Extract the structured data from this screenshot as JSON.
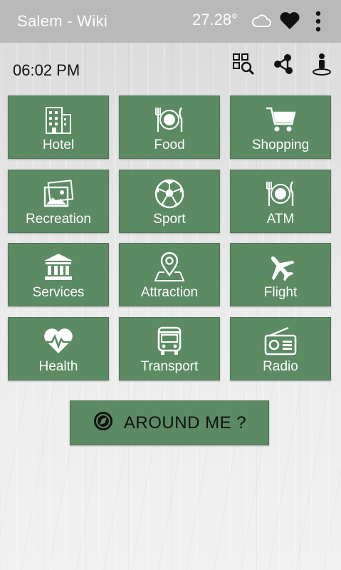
{
  "appbar": {
    "title": "Salem - Wiki",
    "temperature": "27.28°",
    "icons": [
      "cloud-icon",
      "heart-icon",
      "more-vert-icon"
    ]
  },
  "toolbar": {
    "time": "06:02 PM",
    "icons": [
      "qr-search-icon",
      "share-icon",
      "street-view-icon"
    ]
  },
  "tiles": [
    {
      "label": "Hotel",
      "icon": "building-icon"
    },
    {
      "label": "Food",
      "icon": "plate-cutlery-icon"
    },
    {
      "label": "Shopping",
      "icon": "cart-icon"
    },
    {
      "label": "Recreation",
      "icon": "photos-icon"
    },
    {
      "label": "Sport",
      "icon": "soccer-ball-icon"
    },
    {
      "label": "ATM",
      "icon": "plate-cutlery-icon"
    },
    {
      "label": "Services",
      "icon": "bank-icon"
    },
    {
      "label": "Attraction",
      "icon": "map-pin-icon"
    },
    {
      "label": "Flight",
      "icon": "airplane-icon"
    },
    {
      "label": "Health",
      "icon": "heart-pulse-icon"
    },
    {
      "label": "Transport",
      "icon": "bus-icon"
    },
    {
      "label": "Radio",
      "icon": "radio-icon"
    }
  ],
  "around_me": {
    "label": "AROUND ME ?",
    "icon": "compass-icon"
  },
  "colors": {
    "tile": "#5b8a63",
    "appbar": "#b9b9b9"
  }
}
